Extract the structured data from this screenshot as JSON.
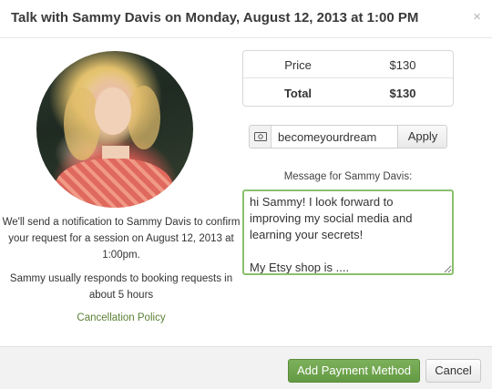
{
  "dialog": {
    "title": "Talk with Sammy Davis on Monday, August 12, 2013 at 1:00 PM",
    "close_glyph": "×"
  },
  "expert": {
    "notification_text": "We'll send a notification to Sammy Davis to confirm your request for a session on August 12, 2013 at 1:00pm.",
    "response_text": "Sammy usually responds to booking requests in about 5 hours",
    "cancellation_link": "Cancellation Policy"
  },
  "pricing": {
    "rows": [
      {
        "label": "Price",
        "value": "$130"
      },
      {
        "label": "Total",
        "value": "$130"
      }
    ]
  },
  "coupon": {
    "icon": "ticket-icon",
    "code": "becomeyourdream",
    "apply_label": "Apply"
  },
  "message": {
    "label": "Message for Sammy Davis:",
    "text": "hi Sammy! I look forward to improving my social media and learning your secrets!\n\nMy Etsy shop is ...."
  },
  "footer": {
    "primary_label": "Add Payment Method",
    "cancel_label": "Cancel"
  },
  "colors": {
    "accent_green": "#6fa44c",
    "link_green": "#5b7f34",
    "focus_border": "#8bc06e"
  }
}
